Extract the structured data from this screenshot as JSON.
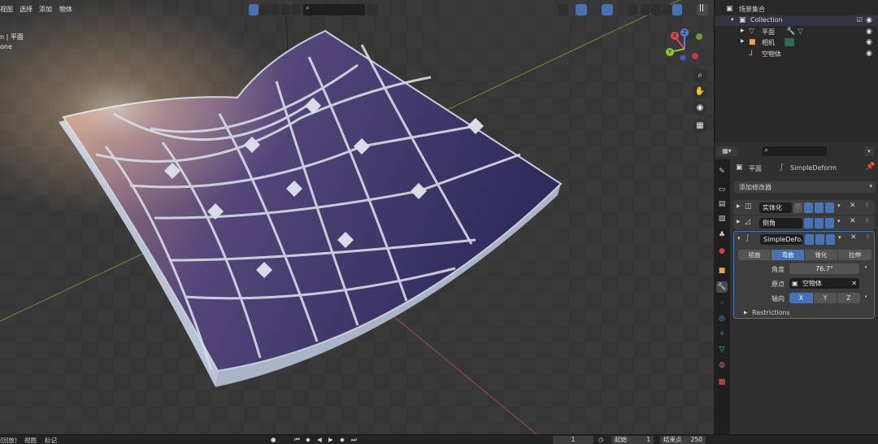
{
  "header": {
    "menus": [
      "视图",
      "选择",
      "添加",
      "物体"
    ],
    "search_placeholder": ""
  },
  "overlay": {
    "line1": "n | 平面",
    "line2": "one"
  },
  "gizmo": {
    "x": "X",
    "y": "Y",
    "z": "Z"
  },
  "outliner": {
    "title": "场景集合",
    "collection": "Collection",
    "items": [
      {
        "label": "平面",
        "icon": "mesh-icon"
      },
      {
        "label": "相机",
        "icon": "camera-icon"
      },
      {
        "label": "空物体",
        "icon": "empty-icon"
      }
    ]
  },
  "properties": {
    "breadcrumb_object": "平面",
    "breadcrumb_modifier": "SimpleDeform",
    "add_modifier": "添加修改器",
    "modifiers": [
      {
        "name": "实体化"
      },
      {
        "name": "倒角"
      },
      {
        "name": "SimpleDefo..."
      }
    ],
    "deform_modes": [
      "扭曲",
      "弯曲",
      "锥化",
      "拉伸"
    ],
    "deform_mode_active": "弯曲",
    "angle_label": "角度",
    "angle_value": "76.7°",
    "origin_label": "原点",
    "origin_value": "空物体",
    "axis_label": "轴向",
    "axes": [
      "X",
      "Y",
      "Z"
    ],
    "axis_active": "X",
    "restrictions": "Restrictions"
  },
  "timeline": {
    "left_menu": "(回放)",
    "view": "视图",
    "marker": "标记",
    "current_frame": "1",
    "start_label": "起始",
    "start_value": "1",
    "end_label": "结束点",
    "end_value": "250"
  },
  "colors": {
    "accent": "#4772b3",
    "panel": "#303030",
    "viewport": "#393939",
    "solar_dark": "#3b3464",
    "solar_warm": "#c98f6a"
  }
}
